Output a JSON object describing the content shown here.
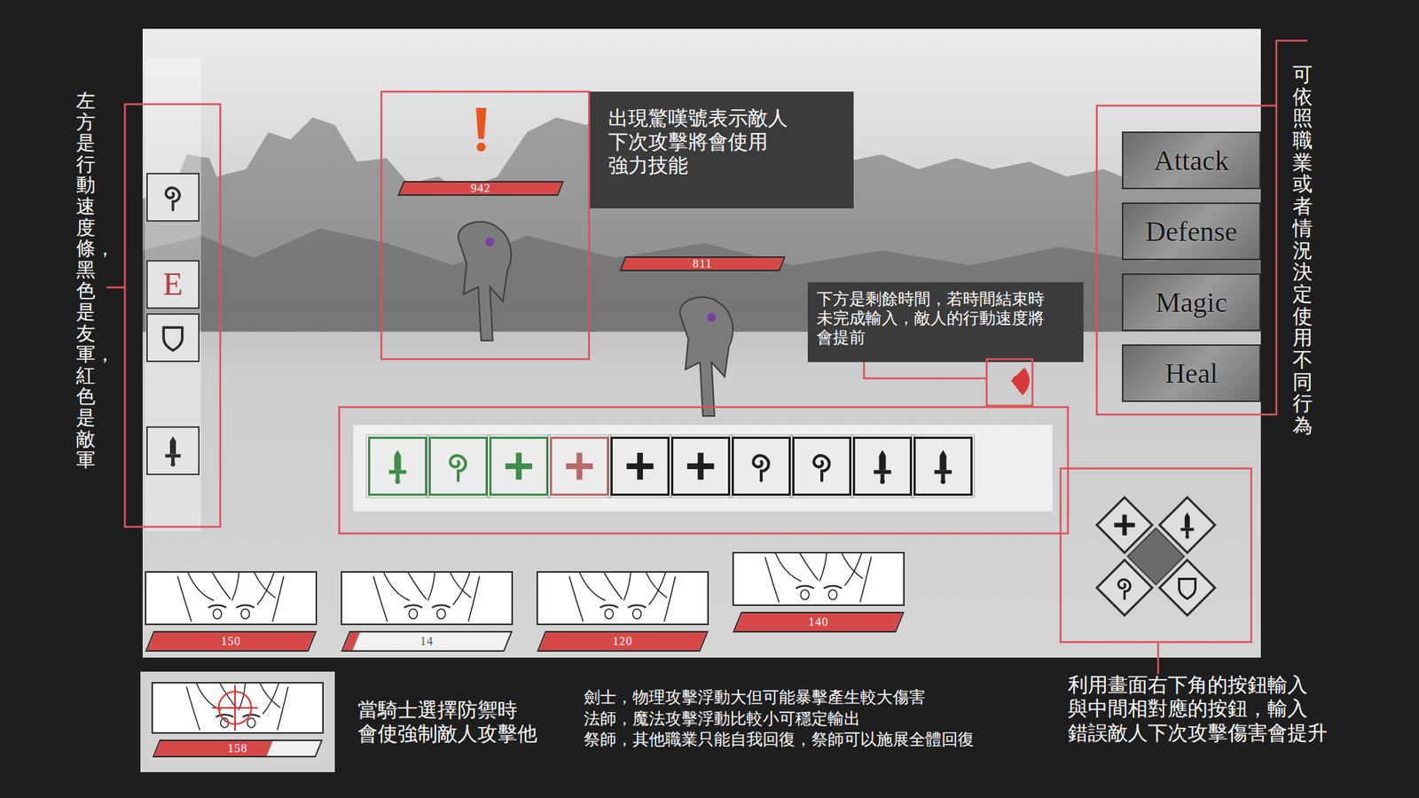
{
  "annotations": {
    "speed_bar": "左方是行動速度條，黑色是友軍，紅色是敵軍",
    "actions": "可依照職業或者情況決定使用不同行為",
    "warning": [
      "出現驚嘆號表示敵人",
      "下次攻擊將會使用",
      "強力技能"
    ],
    "timer": [
      "下方是剩餘時間，若時間結束時",
      "未完成輸入，敵人的行動速度將",
      "會提前"
    ],
    "knight": [
      "當騎士選擇防禦時",
      "會使強制敵人攻擊他"
    ],
    "classes": [
      "劍士，物理攻擊浮動大但可能暴擊產生較大傷害",
      "法師，魔法攻擊浮動比較小可穩定輸出",
      "祭師，其他職業只能自我回復，祭師可以施展全體回復"
    ],
    "input": [
      "利用畫面右下角的按鈕輸入",
      "與中間相對應的按鈕，輸入",
      "錯誤敵人下次攻擊傷害會提升"
    ]
  },
  "speed_bar": [
    {
      "kind": "spiral",
      "color": "#2a2a2a",
      "level": 0.02
    },
    {
      "kind": "letter",
      "text": "E",
      "color": "#b2413f",
      "level": 0.33
    },
    {
      "kind": "shield",
      "color": "#2a2a2a",
      "level": 0.52
    },
    {
      "kind": "sword",
      "color": "#2a2a2a",
      "level": 0.92
    }
  ],
  "enemies": [
    {
      "hp": "942",
      "level": 1,
      "warning": true
    },
    {
      "hp": "811",
      "level": 1,
      "warning": false
    }
  ],
  "timer": {
    "level": 0.27
  },
  "actions": [
    {
      "label": "Attack"
    },
    {
      "label": "Defense"
    },
    {
      "label": "Magic"
    },
    {
      "label": "Heal"
    }
  ],
  "input_sequence": [
    {
      "kind": "sword",
      "color": "#3e8e4a"
    },
    {
      "kind": "spiral",
      "color": "#3e8e4a"
    },
    {
      "kind": "plus",
      "color": "#3e8e4a"
    },
    {
      "kind": "plus",
      "color": "#b86a6a"
    },
    {
      "kind": "plus",
      "color": "#1f1f1f"
    },
    {
      "kind": "plus",
      "color": "#1f1f1f"
    },
    {
      "kind": "spiral",
      "color": "#1f1f1f"
    },
    {
      "kind": "spiral",
      "color": "#1f1f1f"
    },
    {
      "kind": "sword",
      "color": "#1f1f1f"
    },
    {
      "kind": "sword",
      "color": "#1f1f1f"
    }
  ],
  "pad": [
    {
      "kind": "sword"
    },
    {
      "kind": "plus"
    },
    {
      "kind": "shield"
    },
    {
      "kind": "spiral"
    }
  ],
  "party": [
    {
      "hp": "150",
      "level": 1,
      "active": false
    },
    {
      "hp": "14",
      "level": 0.06,
      "active": false
    },
    {
      "hp": "120",
      "level": 1,
      "active": false
    },
    {
      "hp": "140",
      "level": 1,
      "active": true
    }
  ],
  "knight_example": {
    "hp": "158",
    "level": 0.7,
    "targeted": true
  }
}
